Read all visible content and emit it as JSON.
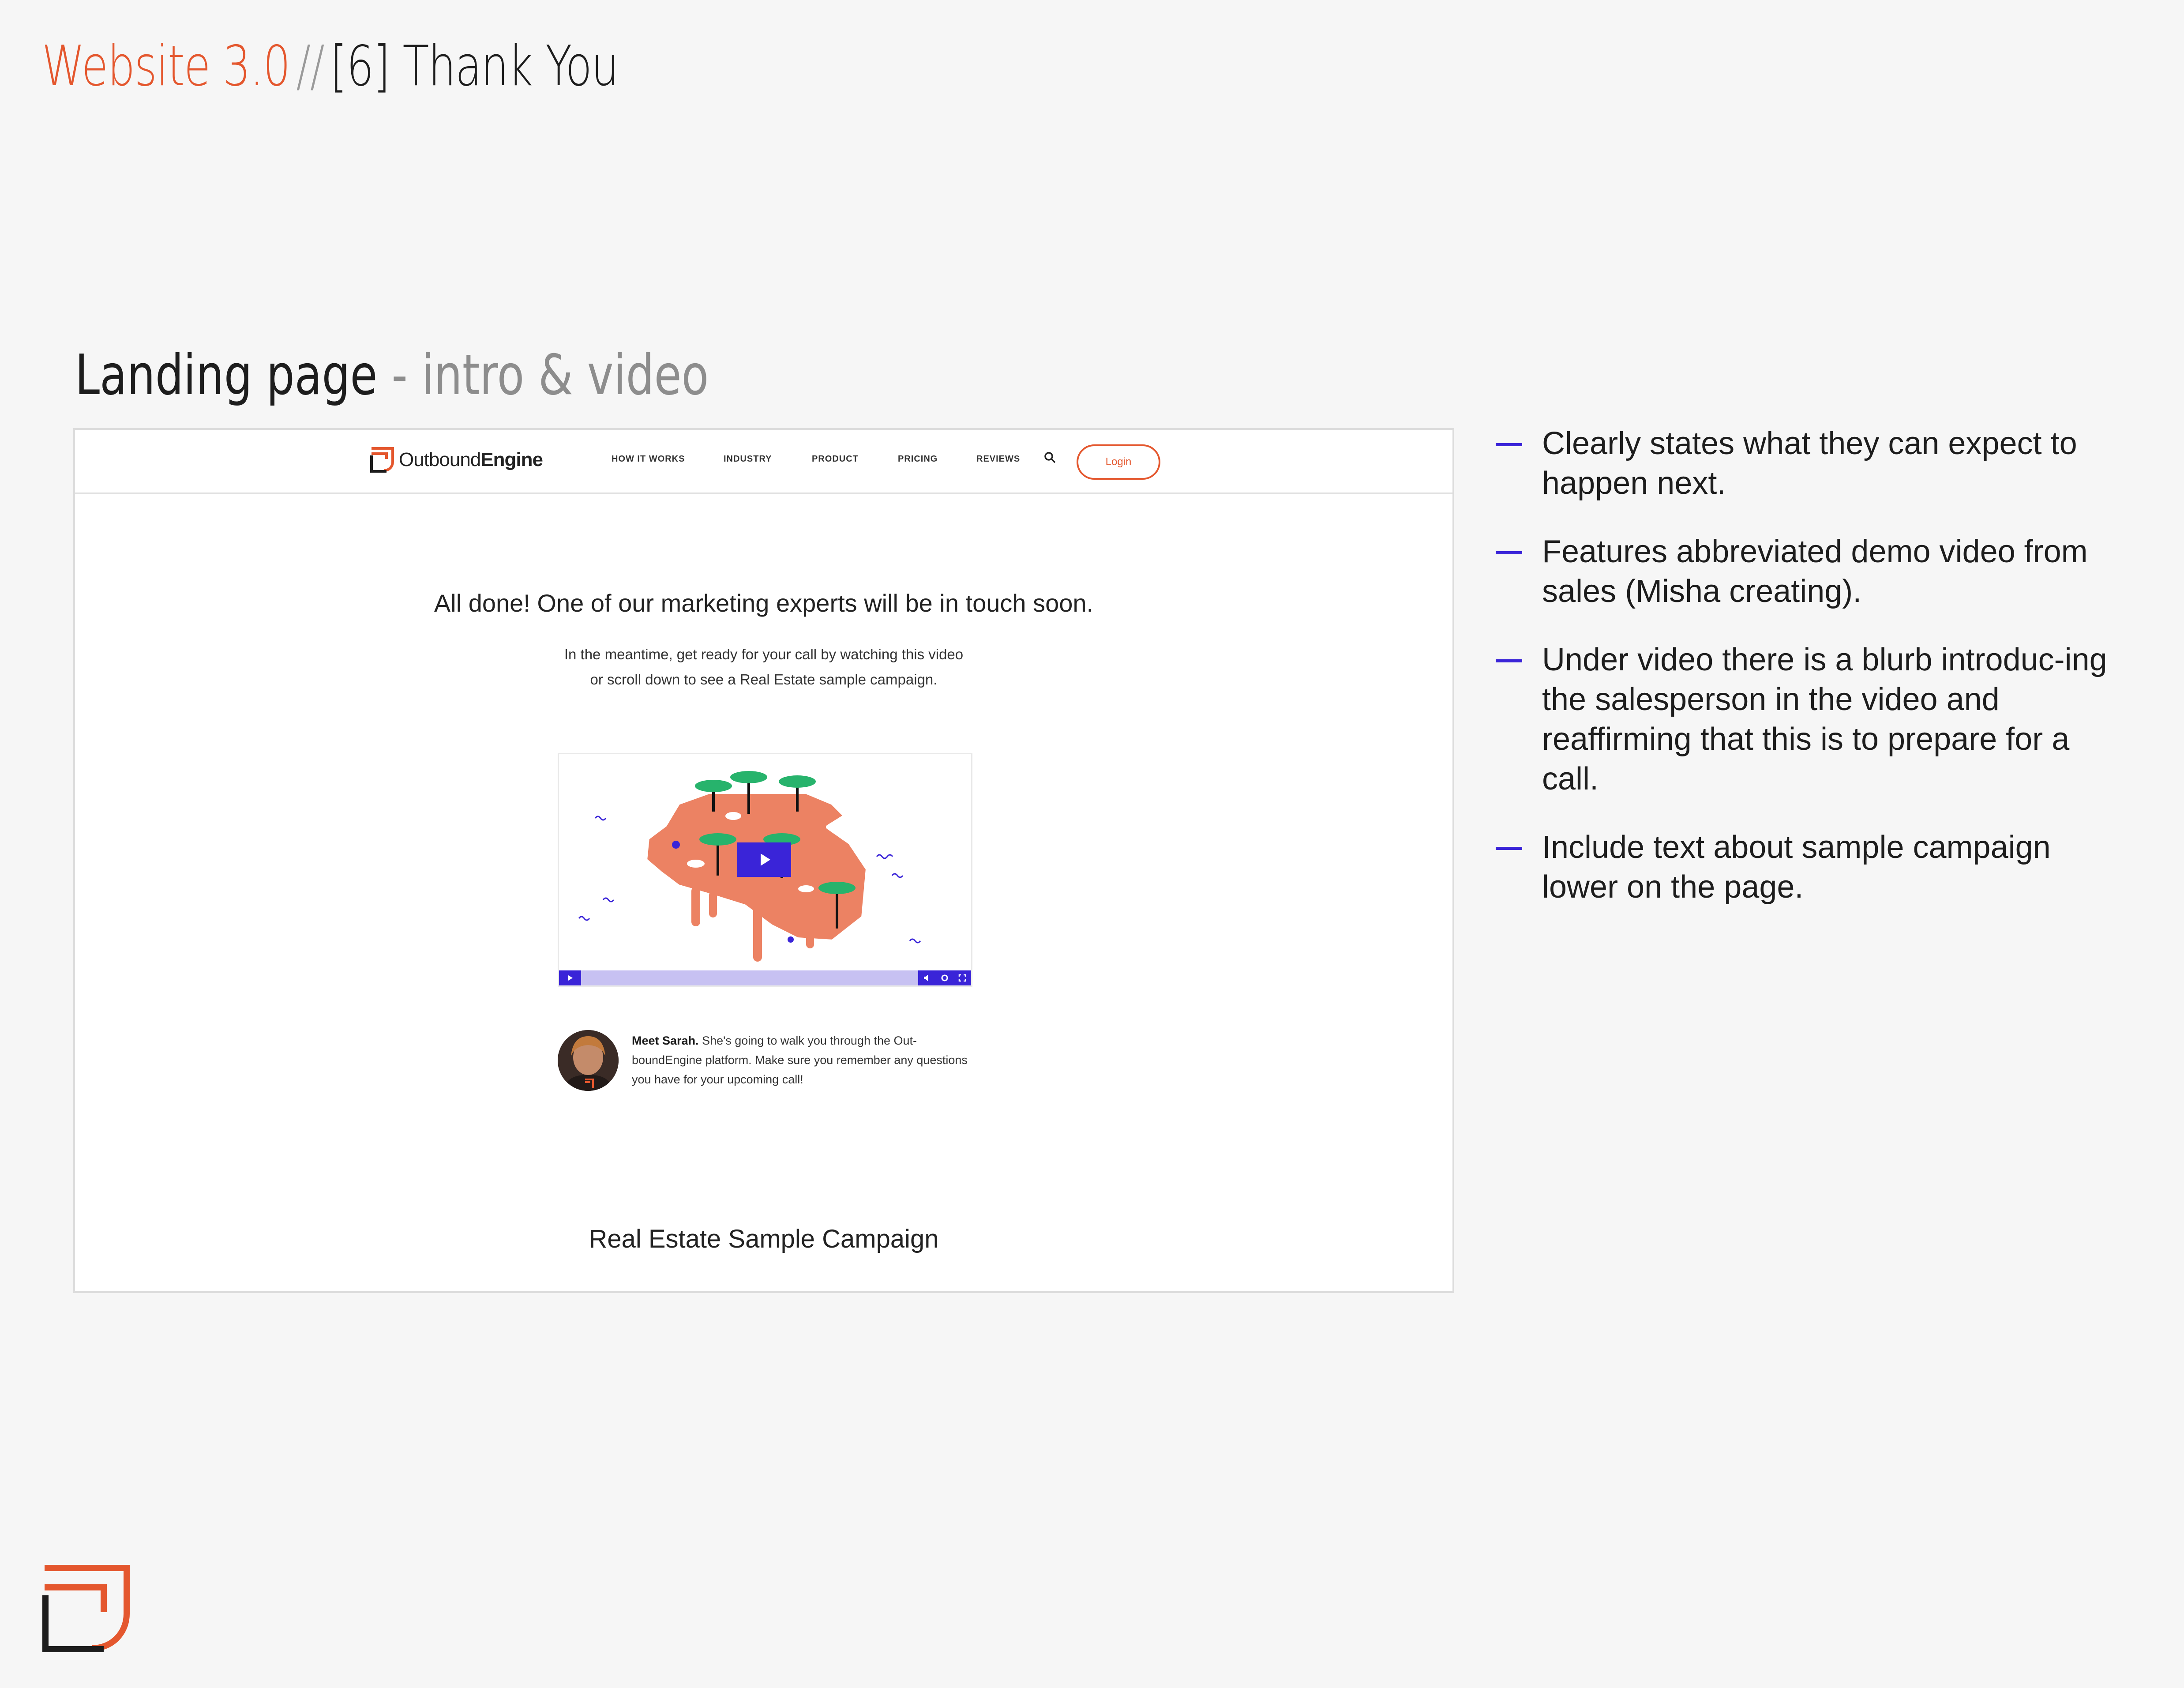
{
  "header": {
    "project": "Website 3.0",
    "separator": "//",
    "page": "[6] Thank You"
  },
  "section": {
    "title": "Landing page",
    "subtitle": " - intro & video"
  },
  "mockup": {
    "brand": {
      "name_light": "Outbound",
      "name_bold": "Engine",
      "icon": "outboundengine-logo-icon"
    },
    "nav": [
      {
        "label": "HOW IT WORKS"
      },
      {
        "label": "INDUSTRY"
      },
      {
        "label": "PRODUCT"
      },
      {
        "label": "PRICING"
      },
      {
        "label": "REVIEWS"
      }
    ],
    "search_icon": "search-icon",
    "login_label": "Login",
    "headline": "All done! One of our marketing experts will be in touch soon.",
    "subtext_line1": "In the meantime, get ready for your call by watching this video",
    "subtext_line2": "or scroll down to see a Real Estate sample campaign.",
    "video": {
      "play_icon": "play-icon",
      "controls": [
        "volume-icon",
        "settings-icon",
        "fullscreen-icon"
      ]
    },
    "presenter": {
      "name": "Meet Sarah.",
      "blurb": " She's going to walk you through the Out-boundEngine platform. Make sure you remember any questions you have for your upcoming call!"
    },
    "campaign_heading": "Real Estate Sample Campaign"
  },
  "notes": [
    "Clearly states what they can expect to happen next.",
    "Features abbreviated demo video from sales (Misha creating).",
    "Under video there is a blurb introduc-ing the salesperson in the video and reaffirming that this is to prepare for a call.",
    "Include text about sample campaign lower on the page."
  ],
  "colors": {
    "accent_orange": "#e4572e",
    "accent_blue": "#3a24d8",
    "background": "#f6f6f6"
  }
}
